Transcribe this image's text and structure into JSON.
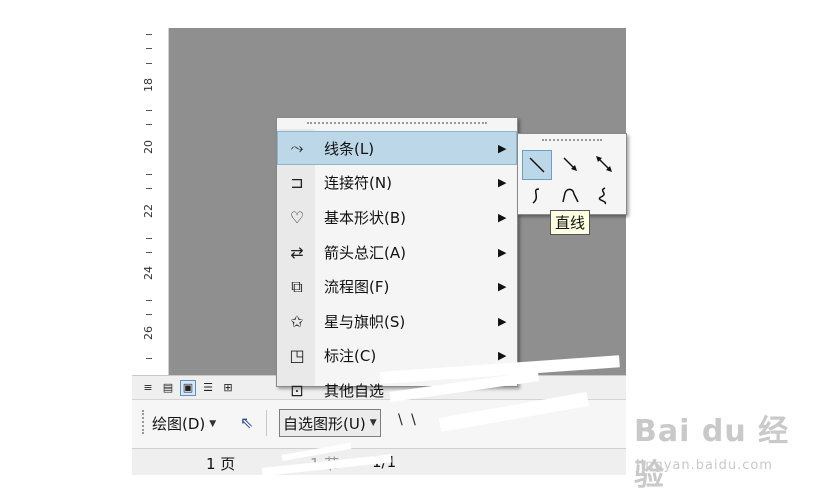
{
  "ruler": {
    "numbers": [
      "18",
      "20",
      "22",
      "24",
      "26"
    ]
  },
  "view_buttons": [
    {
      "name": "normal-view-icon",
      "glyph": "≡"
    },
    {
      "name": "web-view-icon",
      "glyph": "▤"
    },
    {
      "name": "print-view-icon",
      "glyph": "▣"
    },
    {
      "name": "outline-view-icon",
      "glyph": "☰"
    },
    {
      "name": "reading-view-icon",
      "glyph": "⊞"
    }
  ],
  "drawing_toolbar": {
    "draw_label": "绘图(D)",
    "autoshapes_label": "自选图形(U)",
    "line_tools": "\\ \\"
  },
  "statusbar": {
    "page": "1 页",
    "section": "1 节",
    "position": "1/1"
  },
  "autoshapes_menu": {
    "items": [
      {
        "label": "线条(L)",
        "icon": "lines-icon",
        "glyph": "⤳",
        "highlighted": true,
        "submenu": true
      },
      {
        "label": "连接符(N)",
        "icon": "connectors-icon",
        "glyph": "⊐",
        "submenu": true
      },
      {
        "label": "基本形状(B)",
        "icon": "basic-shapes-icon",
        "glyph": "♡",
        "submenu": true
      },
      {
        "label": "箭头总汇(A)",
        "icon": "block-arrows-icon",
        "glyph": "⇄",
        "submenu": true
      },
      {
        "label": "流程图(F)",
        "icon": "flowchart-icon",
        "glyph": "⧉",
        "submenu": true
      },
      {
        "label": "星与旗帜(S)",
        "icon": "stars-banners-icon",
        "glyph": "✩",
        "submenu": true
      },
      {
        "label": "标注(C)",
        "icon": "callouts-icon",
        "glyph": "◳",
        "submenu": true
      },
      {
        "label": "其他自选",
        "icon": "more-autoshapes-icon",
        "glyph": "⊡",
        "submenu": false
      }
    ]
  },
  "lines_submenu": {
    "cells": [
      "line-icon",
      "arrow-icon",
      "double-arrow-icon",
      "curve-icon",
      "freeform-icon",
      "scribble-icon"
    ],
    "tooltip": "直线"
  },
  "watermark": {
    "brand": "Bai du 经验",
    "url": "jingyan.baidu.com"
  },
  "colors": {
    "canvas": "#8f8f8f",
    "highlight": "#bcd8e8",
    "tooltip_bg": "#ffffe1"
  }
}
